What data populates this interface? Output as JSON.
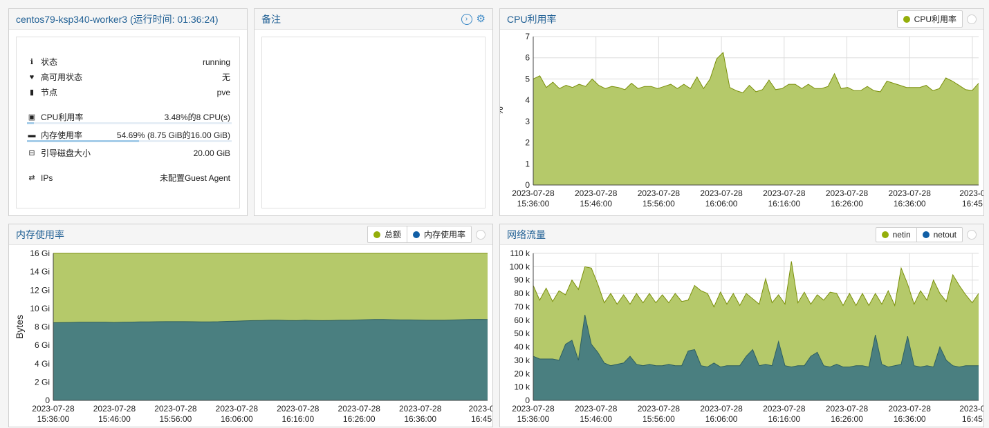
{
  "summary": {
    "title": "centos79-ksp340-worker3 (运行时间: 01:36:24)",
    "status_label": "状态",
    "status_value": "running",
    "ha_label": "高可用状态",
    "ha_value": "无",
    "node_label": "节点",
    "node_value": "pve",
    "cpu_label": "CPU利用率",
    "cpu_value": "3.48%的8 CPU(s)",
    "cpu_fraction": 0.0348,
    "mem_label": "内存使用率",
    "mem_value": "54.69% (8.75 GiB的16.00 GiB)",
    "mem_fraction": 0.5469,
    "disk_label": "引导磁盘大小",
    "disk_value": "20.00 GiB",
    "ips_label": "IPs",
    "ips_value": "未配置Guest Agent",
    "icons": [
      "info-icon",
      "heartbeat-icon",
      "server-icon",
      "cpu-icon",
      "memory-icon",
      "hdd-icon",
      "exchange-icon"
    ]
  },
  "notes": {
    "title": "备注",
    "icons": [
      "arrow-right-circle-icon",
      "gear-icon"
    ]
  },
  "cpu_panel": {
    "title": "CPU利用率",
    "legend": [
      "CPU利用率"
    ]
  },
  "mem_panel": {
    "title": "内存使用率",
    "legend": [
      "总额",
      "内存使用率"
    ]
  },
  "net_panel": {
    "title": "网络流量",
    "legend": [
      "netin",
      "netout"
    ]
  },
  "colors": {
    "green": "#94ae0a",
    "green_fill": "#b5c96a",
    "blue": "#115fa6",
    "teal_fill": "#4a7f80",
    "title_blue": "#1f5f94"
  },
  "chart_data": [
    {
      "type": "area",
      "title": "CPU利用率",
      "ylabel": "%",
      "ylim": [
        0,
        7
      ],
      "yticks": [
        "0",
        "1",
        "2",
        "3",
        "4",
        "5",
        "6",
        "7"
      ],
      "xticks": [
        {
          "date": "2023-07-28",
          "time": "15:36:00"
        },
        {
          "date": "2023-07-28",
          "time": "15:46:00"
        },
        {
          "date": "2023-07-28",
          "time": "15:56:00"
        },
        {
          "date": "2023-07-28",
          "time": "16:06:00"
        },
        {
          "date": "2023-07-28",
          "time": "16:16:00"
        },
        {
          "date": "2023-07-28",
          "time": "16:26:00"
        },
        {
          "date": "2023-07-28",
          "time": "16:36:00"
        },
        {
          "date": "2023-0",
          "time": "16:45"
        }
      ],
      "grid": true,
      "series": [
        {
          "name": "CPU利用率",
          "color": "#94ae0a",
          "values": [
            5.0,
            5.15,
            4.6,
            4.85,
            4.55,
            4.7,
            4.6,
            4.75,
            4.65,
            5.0,
            4.7,
            4.55,
            4.65,
            4.6,
            4.5,
            4.8,
            4.55,
            4.65,
            4.65,
            4.55,
            4.65,
            4.75,
            4.55,
            4.75,
            4.55,
            5.1,
            4.55,
            5.0,
            5.95,
            6.25,
            4.6,
            4.45,
            4.35,
            4.7,
            4.4,
            4.5,
            4.95,
            4.5,
            4.55,
            4.75,
            4.75,
            4.55,
            4.75,
            4.55,
            4.55,
            4.65,
            5.25,
            4.55,
            4.6,
            4.45,
            4.45,
            4.65,
            4.45,
            4.4,
            4.9,
            4.8,
            4.7,
            4.6,
            4.6,
            4.6,
            4.7,
            4.45,
            4.55,
            5.05,
            4.9,
            4.7,
            4.5,
            4.45,
            4.8
          ]
        }
      ]
    },
    {
      "type": "area",
      "title": "内存使用率",
      "ylabel": "Bytes",
      "ylim": [
        0,
        16
      ],
      "yticks": [
        "0",
        "2 Gi",
        "4 Gi",
        "6 Gi",
        "8 Gi",
        "10 Gi",
        "12 Gi",
        "14 Gi",
        "16 Gi"
      ],
      "xticks": [
        {
          "date": "2023-07-28",
          "time": "15:36:00"
        },
        {
          "date": "2023-07-28",
          "time": "15:46:00"
        },
        {
          "date": "2023-07-28",
          "time": "15:56:00"
        },
        {
          "date": "2023-07-28",
          "time": "16:06:00"
        },
        {
          "date": "2023-07-28",
          "time": "16:16:00"
        },
        {
          "date": "2023-07-28",
          "time": "16:26:00"
        },
        {
          "date": "2023-07-28",
          "time": "16:36:00"
        },
        {
          "date": "2023-0",
          "time": "16:45"
        }
      ],
      "grid": true,
      "series": [
        {
          "name": "总额",
          "color": "#94ae0a",
          "values": [
            16,
            16,
            16,
            16,
            16,
            16,
            16,
            16,
            16,
            16,
            16,
            16,
            16,
            16,
            16,
            16,
            16,
            16,
            16,
            16,
            16,
            16,
            16,
            16,
            16,
            16,
            16,
            16,
            16,
            16,
            16,
            16,
            16,
            16,
            16,
            16,
            16,
            16,
            16,
            16,
            16,
            16,
            16,
            16,
            16,
            16,
            16,
            16,
            16,
            16,
            16
          ]
        },
        {
          "name": "内存使用率",
          "color": "#115fa6",
          "values": [
            8.45,
            8.47,
            8.48,
            8.5,
            8.5,
            8.5,
            8.5,
            8.48,
            8.5,
            8.52,
            8.55,
            8.55,
            8.56,
            8.57,
            8.57,
            8.57,
            8.56,
            8.55,
            8.55,
            8.56,
            8.6,
            8.62,
            8.65,
            8.68,
            8.7,
            8.72,
            8.72,
            8.7,
            8.68,
            8.72,
            8.7,
            8.68,
            8.7,
            8.72,
            8.72,
            8.75,
            8.78,
            8.8,
            8.8,
            8.78,
            8.76,
            8.76,
            8.74,
            8.72,
            8.72,
            8.72,
            8.75,
            8.78,
            8.8,
            8.82,
            8.8
          ]
        }
      ]
    },
    {
      "type": "area",
      "title": "网络流量",
      "ylim": [
        0,
        110000
      ],
      "yticks": [
        "0",
        "10 k",
        "20 k",
        "30 k",
        "40 k",
        "50 k",
        "60 k",
        "70 k",
        "80 k",
        "90 k",
        "100 k",
        "110 k"
      ],
      "xticks": [
        {
          "date": "2023-07-28",
          "time": "15:36:00"
        },
        {
          "date": "2023-07-28",
          "time": "15:46:00"
        },
        {
          "date": "2023-07-28",
          "time": "15:56:00"
        },
        {
          "date": "2023-07-28",
          "time": "16:06:00"
        },
        {
          "date": "2023-07-28",
          "time": "16:16:00"
        },
        {
          "date": "2023-07-28",
          "time": "16:26:00"
        },
        {
          "date": "2023-07-28",
          "time": "16:36:00"
        },
        {
          "date": "2023-0",
          "time": "16:45"
        }
      ],
      "grid": true,
      "series": [
        {
          "name": "netin",
          "color": "#94ae0a",
          "values": [
            86000,
            75000,
            84000,
            74000,
            82000,
            79000,
            90000,
            83000,
            100000,
            99000,
            87000,
            73000,
            80000,
            72000,
            79000,
            72000,
            80000,
            73000,
            80000,
            73000,
            79000,
            73000,
            80000,
            74000,
            75000,
            86000,
            82000,
            80000,
            70000,
            81000,
            72000,
            80000,
            71000,
            80000,
            76000,
            72000,
            91000,
            73000,
            79000,
            72000,
            104000,
            73000,
            81000,
            72000,
            79000,
            75000,
            81000,
            80000,
            71000,
            80000,
            71000,
            80000,
            71000,
            80000,
            72000,
            82000,
            71000,
            99000,
            87000,
            72000,
            82000,
            75000,
            90000,
            80000,
            74000,
            94000,
            86000,
            79000,
            73000,
            80000
          ]
        },
        {
          "name": "netout",
          "color": "#115fa6",
          "values": [
            33000,
            31000,
            31000,
            31000,
            30000,
            42000,
            45000,
            30000,
            64000,
            42000,
            36000,
            28000,
            26000,
            27000,
            28000,
            33000,
            27000,
            26000,
            27000,
            26000,
            26000,
            27000,
            26000,
            26000,
            37000,
            38000,
            26000,
            25000,
            28000,
            25000,
            26000,
            26000,
            26000,
            33000,
            38000,
            26000,
            27000,
            26000,
            44000,
            26000,
            25000,
            26000,
            26000,
            33000,
            36000,
            26000,
            25000,
            27000,
            25000,
            25000,
            26000,
            26000,
            25000,
            49000,
            27000,
            25000,
            26000,
            27000,
            48000,
            26000,
            25000,
            26000,
            25000,
            40000,
            30000,
            26000,
            25000,
            26000,
            26000,
            26000
          ]
        }
      ]
    }
  ]
}
